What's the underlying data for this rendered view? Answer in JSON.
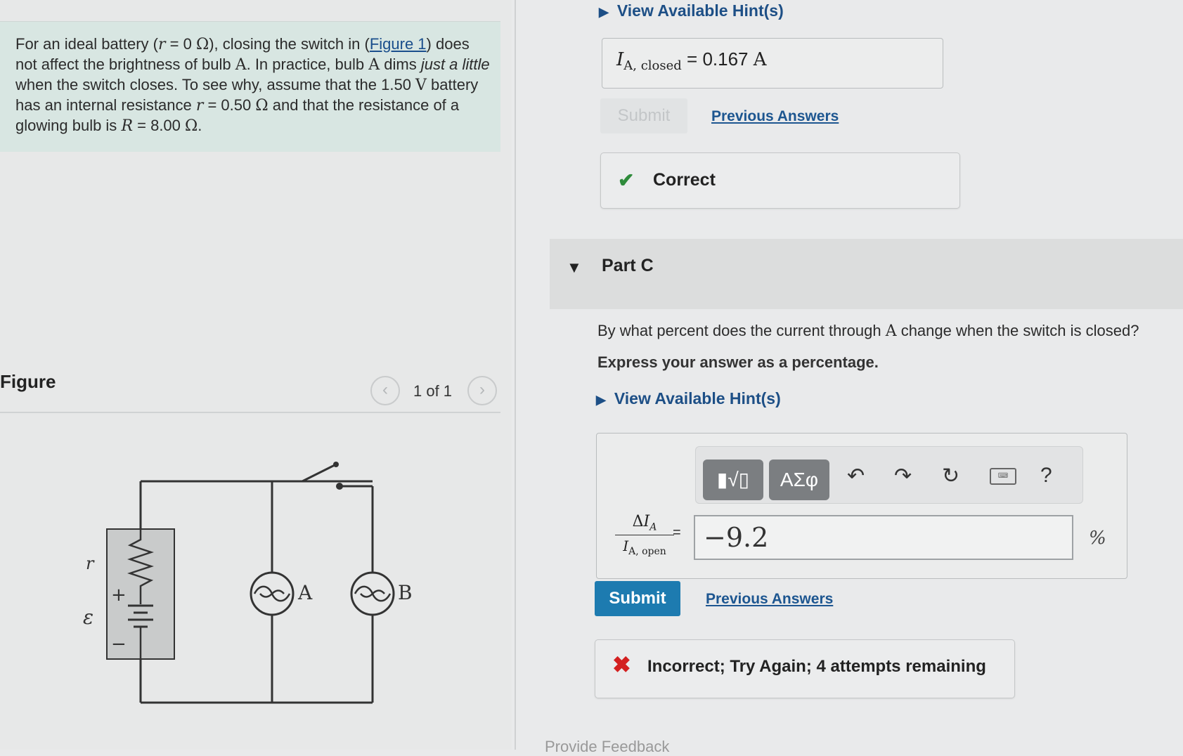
{
  "problem": {
    "text_html_parts": {
      "p1": "For an ideal battery (",
      "r_sym": "r",
      "r_eq": " = 0 ",
      "omega": "Ω",
      "p2": "), closing the switch in (",
      "figure_link": "Figure 1",
      "p3": ") does not affect the brightness of bulb ",
      "bulb_a": "A",
      "p4": ". In practice, bulb ",
      "bulb_a2": "A",
      "p5": " dims ",
      "emph": "just a little",
      "p6": " when the switch closes. To see why, assume that the 1.50 ",
      "volt": "V",
      "p7": " battery has an internal resistance ",
      "r_sym2": "r",
      "p8": " = 0.50 ",
      "omega2": "Ω",
      "p9": " and that the resistance of a glowing bulb is ",
      "R_sym": "R",
      "p10": " = 8.00 ",
      "omega3": "Ω",
      "p11": "."
    }
  },
  "figure": {
    "title": "Figure",
    "counter": "1 of 1",
    "prev_icon": "‹",
    "next_icon": "›",
    "labels": {
      "r": "r",
      "emf": "ε",
      "plus": "+",
      "minus": "−",
      "bulb_a": "A",
      "bulb_b": "B"
    }
  },
  "part_b": {
    "hint_label": "View Available Hint(s)",
    "answer_var": "I",
    "answer_sub": "A, closed",
    "answer_value": "= 0.167 ",
    "answer_unit": "A",
    "submit_label": "Submit",
    "previous_answers_label": "Previous Answers",
    "feedback_label": "Correct",
    "feedback_icon": "check-icon"
  },
  "part_c": {
    "title": "Part C",
    "question_prefix": "By what percent does the current through ",
    "question_var": "A",
    "question_suffix": " change when the switch is closed?",
    "instruction": "Express your answer as a percentage.",
    "hint_label": "View Available Hint(s)",
    "toolbar": {
      "templates_label": "▮√▯",
      "symbols_label": "ΑΣφ",
      "undo_icon": "↶",
      "redo_icon": "↷",
      "reset_icon": "↻",
      "keyboard_icon": "⌨",
      "help_icon": "?"
    },
    "fraction_num_delta": "Δ",
    "fraction_num_var": "I",
    "fraction_num_sub": "A",
    "fraction_den_var": "I",
    "fraction_den_sub": "A, open",
    "equals": "=",
    "input_value": "−9.2",
    "unit": "%",
    "submit_label": "Submit",
    "previous_answers_label": "Previous Answers",
    "feedback_label": "Incorrect; Try Again; 4 attempts remaining",
    "feedback_icon": "x-icon"
  },
  "footer_peek": "Provide Feedback",
  "colors": {
    "link": "#1d4f86",
    "submit": "#1d7bb0",
    "correct": "#2e8b3b",
    "incorrect": "#d32020",
    "problem_bg": "#d8e6e2"
  }
}
